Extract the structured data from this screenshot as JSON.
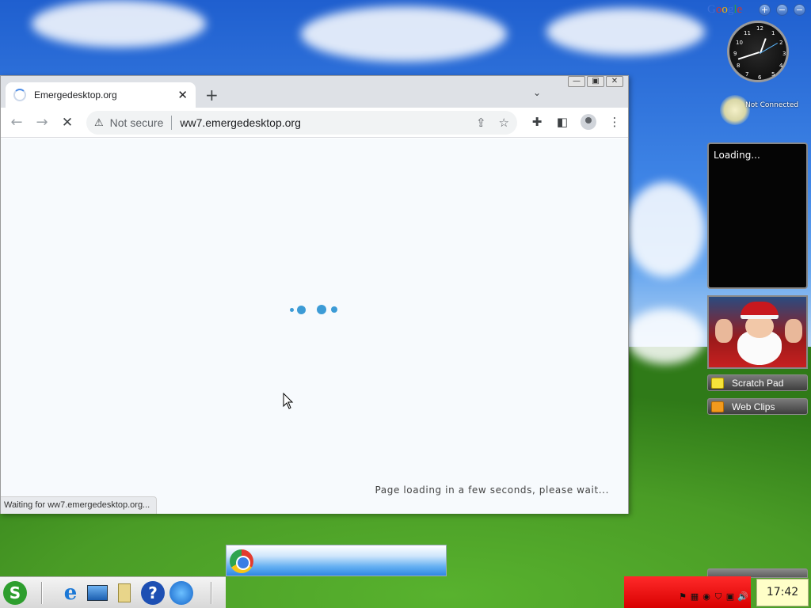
{
  "browser": {
    "tab_title": "Emergedesktop.org",
    "tab_close": "✕",
    "new_tab": "+",
    "tab_search": "⌄",
    "win_buttons": {
      "minimize": "—",
      "maximize": "▣",
      "close": "✕"
    },
    "nav": {
      "back": "←",
      "forward": "→",
      "stop": "✕"
    },
    "security_icon": "⚠",
    "security_label": "Not secure",
    "url": "ww7.emergedesktop.org",
    "share_icon": "⇪",
    "bookmark_icon": "☆",
    "extensions_icon": "✚",
    "sidepanel_icon": "◧",
    "menu_icon": "⋮",
    "loading_message": "Page loading in a few seconds, please wait...",
    "status_text": "Waiting for ww7.emergedesktop.org..."
  },
  "gadgets": {
    "sidebar_title_letters": [
      "G",
      "o",
      "o",
      "g",
      "l",
      "e"
    ],
    "sidebar_title_colors": [
      "#3b6fd8",
      "#d8352a",
      "#f4b400",
      "#3b6fd8",
      "#2e9e45",
      "#d8352a"
    ],
    "add_button": "+",
    "menu_button": "−",
    "close_button": "−",
    "clock_numbers": [
      "12",
      "1",
      "2",
      "3",
      "4",
      "5",
      "6",
      "7",
      "8",
      "9",
      "10",
      "11"
    ],
    "connection_status": "Not Connected",
    "loading_label": "Loading...",
    "scratch_pad_label": "Scratch Pad",
    "web_clips_label": "Web Clips"
  },
  "taskbar": {
    "time": "17:42",
    "tray_red_color": "#e00000"
  }
}
